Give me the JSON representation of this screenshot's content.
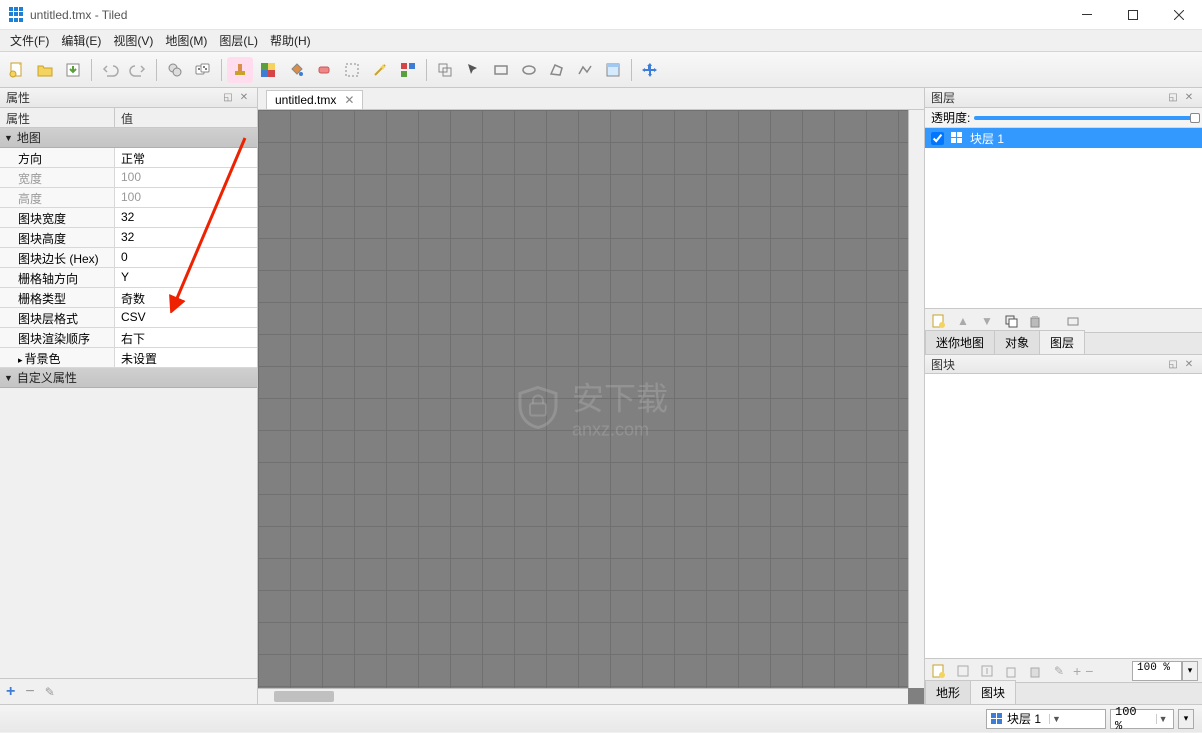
{
  "window": {
    "title": "untitled.tmx - Tiled"
  },
  "menu": {
    "file": "文件(F)",
    "edit": "编辑(E)",
    "view": "视图(V)",
    "map": "地图(M)",
    "layer": "图层(L)",
    "help": "帮助(H)"
  },
  "left_panel": {
    "title": "属性",
    "col_prop": "属性",
    "col_val": "值",
    "group_map": "地图",
    "rows": [
      {
        "k": "方向",
        "v": "正常"
      },
      {
        "k": "宽度",
        "v": "100",
        "dis": true
      },
      {
        "k": "高度",
        "v": "100",
        "dis": true
      },
      {
        "k": "图块宽度",
        "v": "32"
      },
      {
        "k": "图块高度",
        "v": "32"
      },
      {
        "k": "图块边长 (Hex)",
        "v": "0"
      },
      {
        "k": "栅格轴方向",
        "v": "Y"
      },
      {
        "k": "栅格类型",
        "v": "奇数"
      },
      {
        "k": "图块层格式",
        "v": "CSV"
      },
      {
        "k": "图块渲染顺序",
        "v": "右下"
      },
      {
        "k": "背景色",
        "v": "未设置",
        "expand": true
      }
    ],
    "group_custom": "自定义属性"
  },
  "center": {
    "tab": "untitled.tmx",
    "watermark": "安下载",
    "watermark_url": "anxz.com"
  },
  "right": {
    "layers_title": "图层",
    "opacity_label": "透明度:",
    "layer1": "块层 1",
    "tabs": {
      "minimap": "迷你地图",
      "objects": "对象",
      "layers": "图层"
    },
    "tileset_title": "图块",
    "tileset_tabs": {
      "terrain": "地形",
      "tiles": "图块"
    }
  },
  "status": {
    "layer_combo": "块层 1",
    "zoom": "100 %"
  },
  "tileset_zoom": "100 %"
}
